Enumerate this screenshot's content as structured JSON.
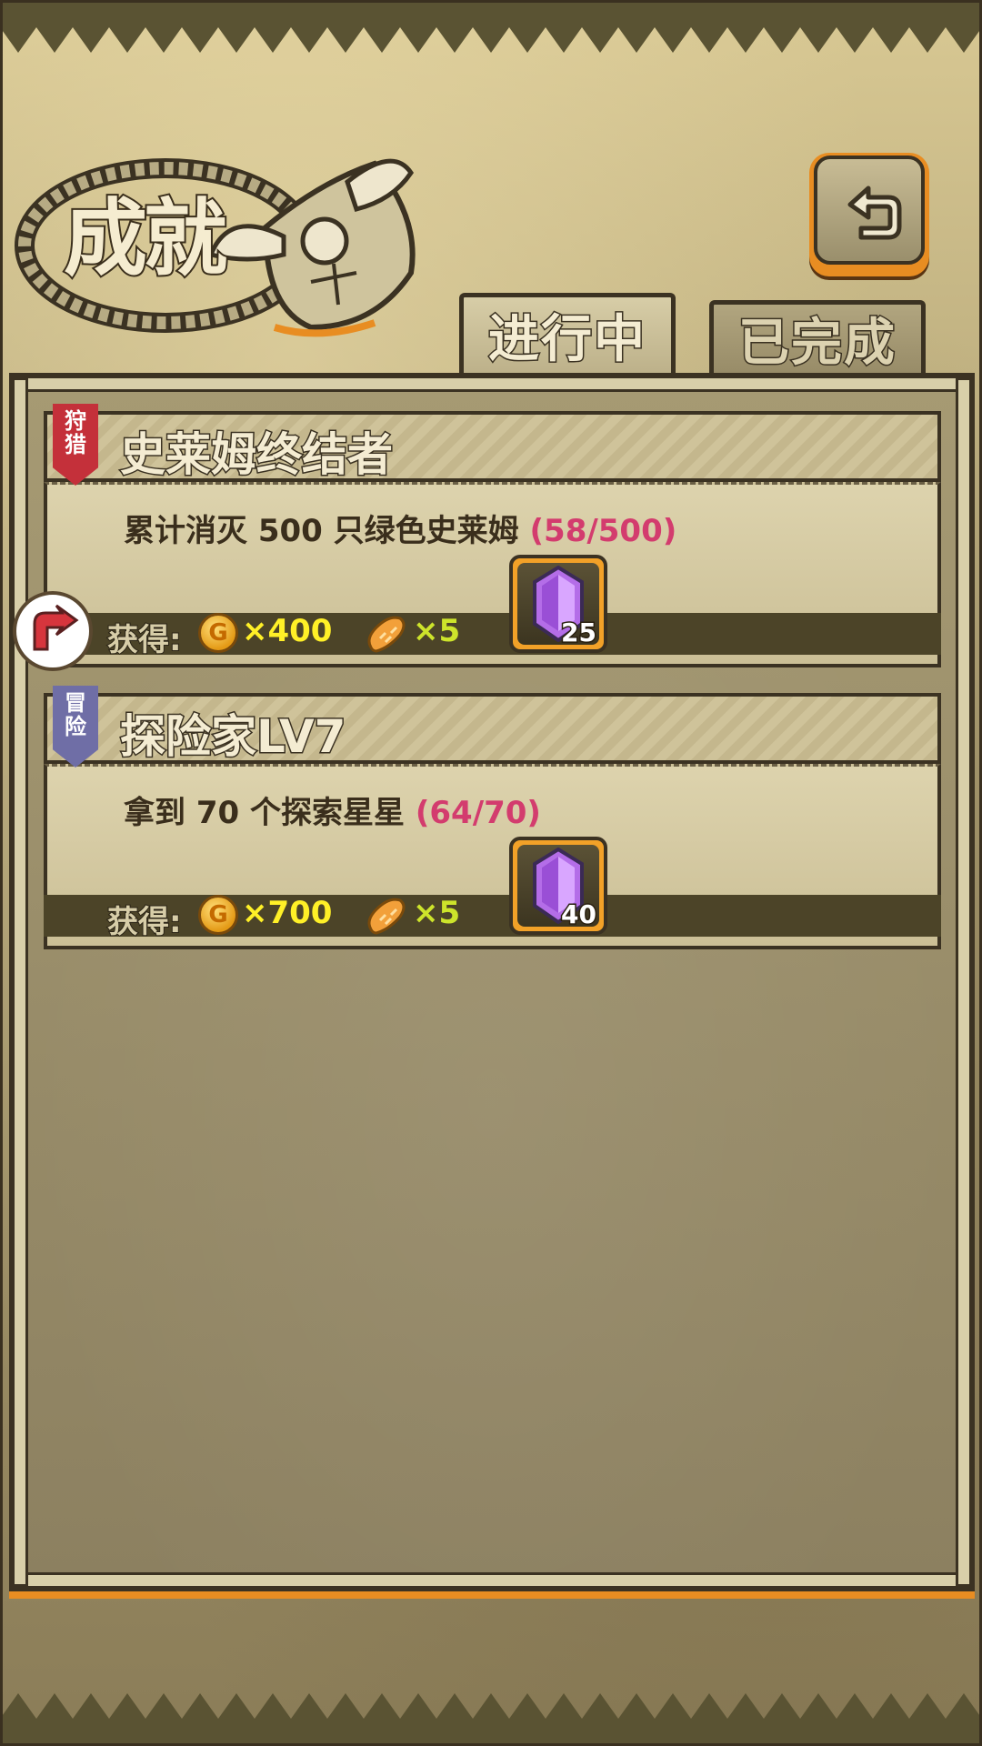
{
  "header": {
    "title": "成就",
    "back_icon": "back-arrow-icon"
  },
  "tabs": [
    {
      "label": "进行中",
      "active": true
    },
    {
      "label": "已完成",
      "active": false
    }
  ],
  "achievements": [
    {
      "category": "狩猎",
      "category_color": "#c4303a",
      "title": "史莱姆终结者",
      "description": "累计消灭 500 只绿色史莱姆",
      "progress": "(58/500)",
      "reward_label": "获得:",
      "coin_amount": "×400",
      "bread_amount": "×5",
      "gem_count": "25"
    },
    {
      "category": "冒险",
      "category_color": "#6f6ea6",
      "title": "探险家LV7",
      "description": "拿到 70 个探索星星",
      "progress": "(64/70)",
      "reward_label": "获得:",
      "coin_amount": "×700",
      "bread_amount": "×5",
      "gem_count": "40"
    }
  ],
  "icons": {
    "coin": "gold-coin-icon",
    "bread": "bread-icon",
    "gem": "purple-gem-icon",
    "share": "share-arrow-icon"
  },
  "colors": {
    "accent_orange": "#e88d22",
    "progress_pink": "#d33c6e",
    "coin_text": "#fff027",
    "bread_text": "#cde42b"
  }
}
